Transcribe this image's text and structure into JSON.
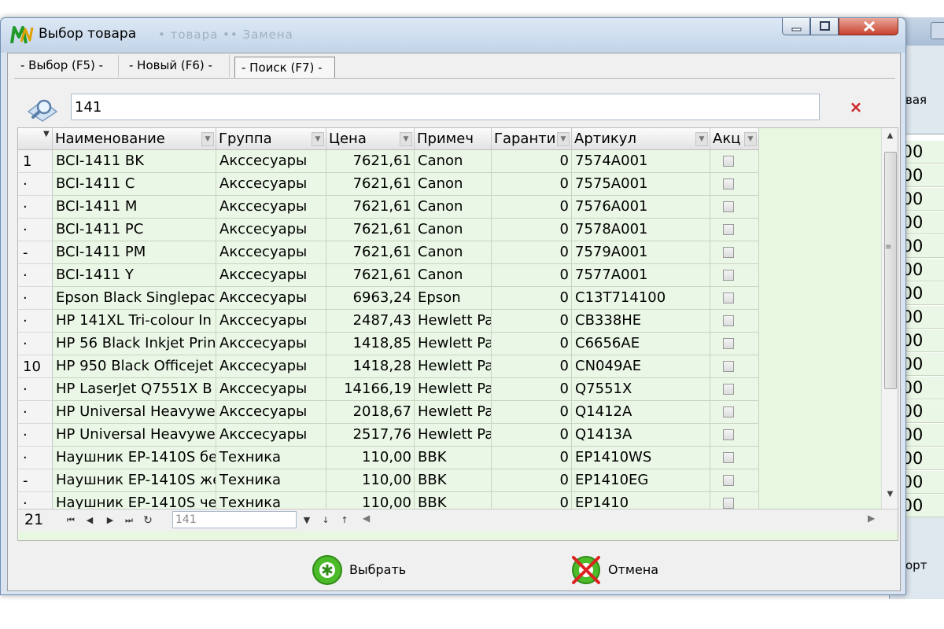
{
  "window": {
    "title": "Выбор товара",
    "title_ghost": "• товара  •• Замена"
  },
  "tabs": [
    {
      "label": "- Выбор (F5) -"
    },
    {
      "label": "- Новый (F6) -"
    },
    {
      "label": "- Поиск (F7) -"
    }
  ],
  "search": {
    "value": "141",
    "clear_glyph": "×"
  },
  "grid": {
    "columns": [
      "Наименование",
      "Группа",
      "Цена",
      "Примеч",
      "Гаранти",
      "Артикул",
      "Акц"
    ],
    "rows": [
      {
        "indicator": "1",
        "name": "BCI-1411 BK",
        "group": "Акссесуары",
        "price": "7621,61",
        "note": "Canon",
        "warranty": "0",
        "sku": "7574A001"
      },
      {
        "indicator": "·",
        "name": "BCI-1411 C",
        "group": "Акссесуары",
        "price": "7621,61",
        "note": "Canon",
        "warranty": "0",
        "sku": "7575A001"
      },
      {
        "indicator": "·",
        "name": "BCI-1411 M",
        "group": "Акссесуары",
        "price": "7621,61",
        "note": "Canon",
        "warranty": "0",
        "sku": "7576A001"
      },
      {
        "indicator": "·",
        "name": "BCI-1411 PC",
        "group": "Акссесуары",
        "price": "7621,61",
        "note": "Canon",
        "warranty": "0",
        "sku": "7578A001"
      },
      {
        "indicator": "-",
        "name": "BCI-1411 PM",
        "group": "Акссесуары",
        "price": "7621,61",
        "note": "Canon",
        "warranty": "0",
        "sku": "7579A001"
      },
      {
        "indicator": "·",
        "name": "BCI-1411 Y",
        "group": "Акссесуары",
        "price": "7621,61",
        "note": "Canon",
        "warranty": "0",
        "sku": "7577A001"
      },
      {
        "indicator": "·",
        "name": "Epson Black Singlepack",
        "group": "Акссесуары",
        "price": "6963,24",
        "note": "Epson",
        "warranty": "0",
        "sku": "C13T714100"
      },
      {
        "indicator": "·",
        "name": "HP 141XL Tri-colour In",
        "group": "Акссесуары",
        "price": "2487,43",
        "note": "Hewlett Pa",
        "warranty": "0",
        "sku": "CB338HE"
      },
      {
        "indicator": "·",
        "name": "HP 56 Black Inkjet Prin",
        "group": "Акссесуары",
        "price": "1418,85",
        "note": "Hewlett Pa",
        "warranty": "0",
        "sku": "C6656AE"
      },
      {
        "indicator": "10",
        "name": "HP 950 Black Officejet",
        "group": "Акссесуары",
        "price": "1418,28",
        "note": "Hewlett Pa",
        "warranty": "0",
        "sku": "CN049AE"
      },
      {
        "indicator": "·",
        "name": "HP LaserJet Q7551X B",
        "group": "Акссесуары",
        "price": "14166,19",
        "note": "Hewlett Pa",
        "warranty": "0",
        "sku": "Q7551X"
      },
      {
        "indicator": "·",
        "name": "HP Universal Heavywe",
        "group": "Акссесуары",
        "price": "2018,67",
        "note": "Hewlett Pa",
        "warranty": "0",
        "sku": "Q1412A"
      },
      {
        "indicator": "·",
        "name": "HP Universal Heavywe",
        "group": "Акссесуары",
        "price": "2517,76",
        "note": "Hewlett Pa",
        "warranty": "0",
        "sku": "Q1413A"
      },
      {
        "indicator": "·",
        "name": "Наушник EP-1410S бе",
        "group": "Техника",
        "price": "110,00",
        "note": "BBK",
        "warranty": "0",
        "sku": "EP1410WS"
      },
      {
        "indicator": "-",
        "name": "Наушник EP-1410S же",
        "group": "Техника",
        "price": "110,00",
        "note": "BBK",
        "warranty": "0",
        "sku": "EP1410EG"
      },
      {
        "indicator": "·",
        "name": "Наушник EP-1410S че",
        "group": "Техника",
        "price": "110,00",
        "note": "BBK",
        "warranty": "0",
        "sku": "EP1410"
      }
    ],
    "record_count": "21",
    "nav_filter_value": "141"
  },
  "buttons": {
    "select": "Выбрать",
    "cancel": "Отмена"
  },
  "background_window": {
    "label_top": "вая",
    "label_bottom": "орт",
    "cells": [
      ".00",
      ".00",
      ".00",
      ".00",
      ".00",
      ".00",
      ".00",
      ".00",
      ".00",
      ".00",
      ".00",
      ".00",
      ".00",
      ".00",
      ".00",
      ".00"
    ]
  },
  "icons": {
    "app": "app-logo-icon",
    "search": "magnifier-icon",
    "select": "green-asterisk-icon",
    "cancel": "red-cross-icon"
  }
}
